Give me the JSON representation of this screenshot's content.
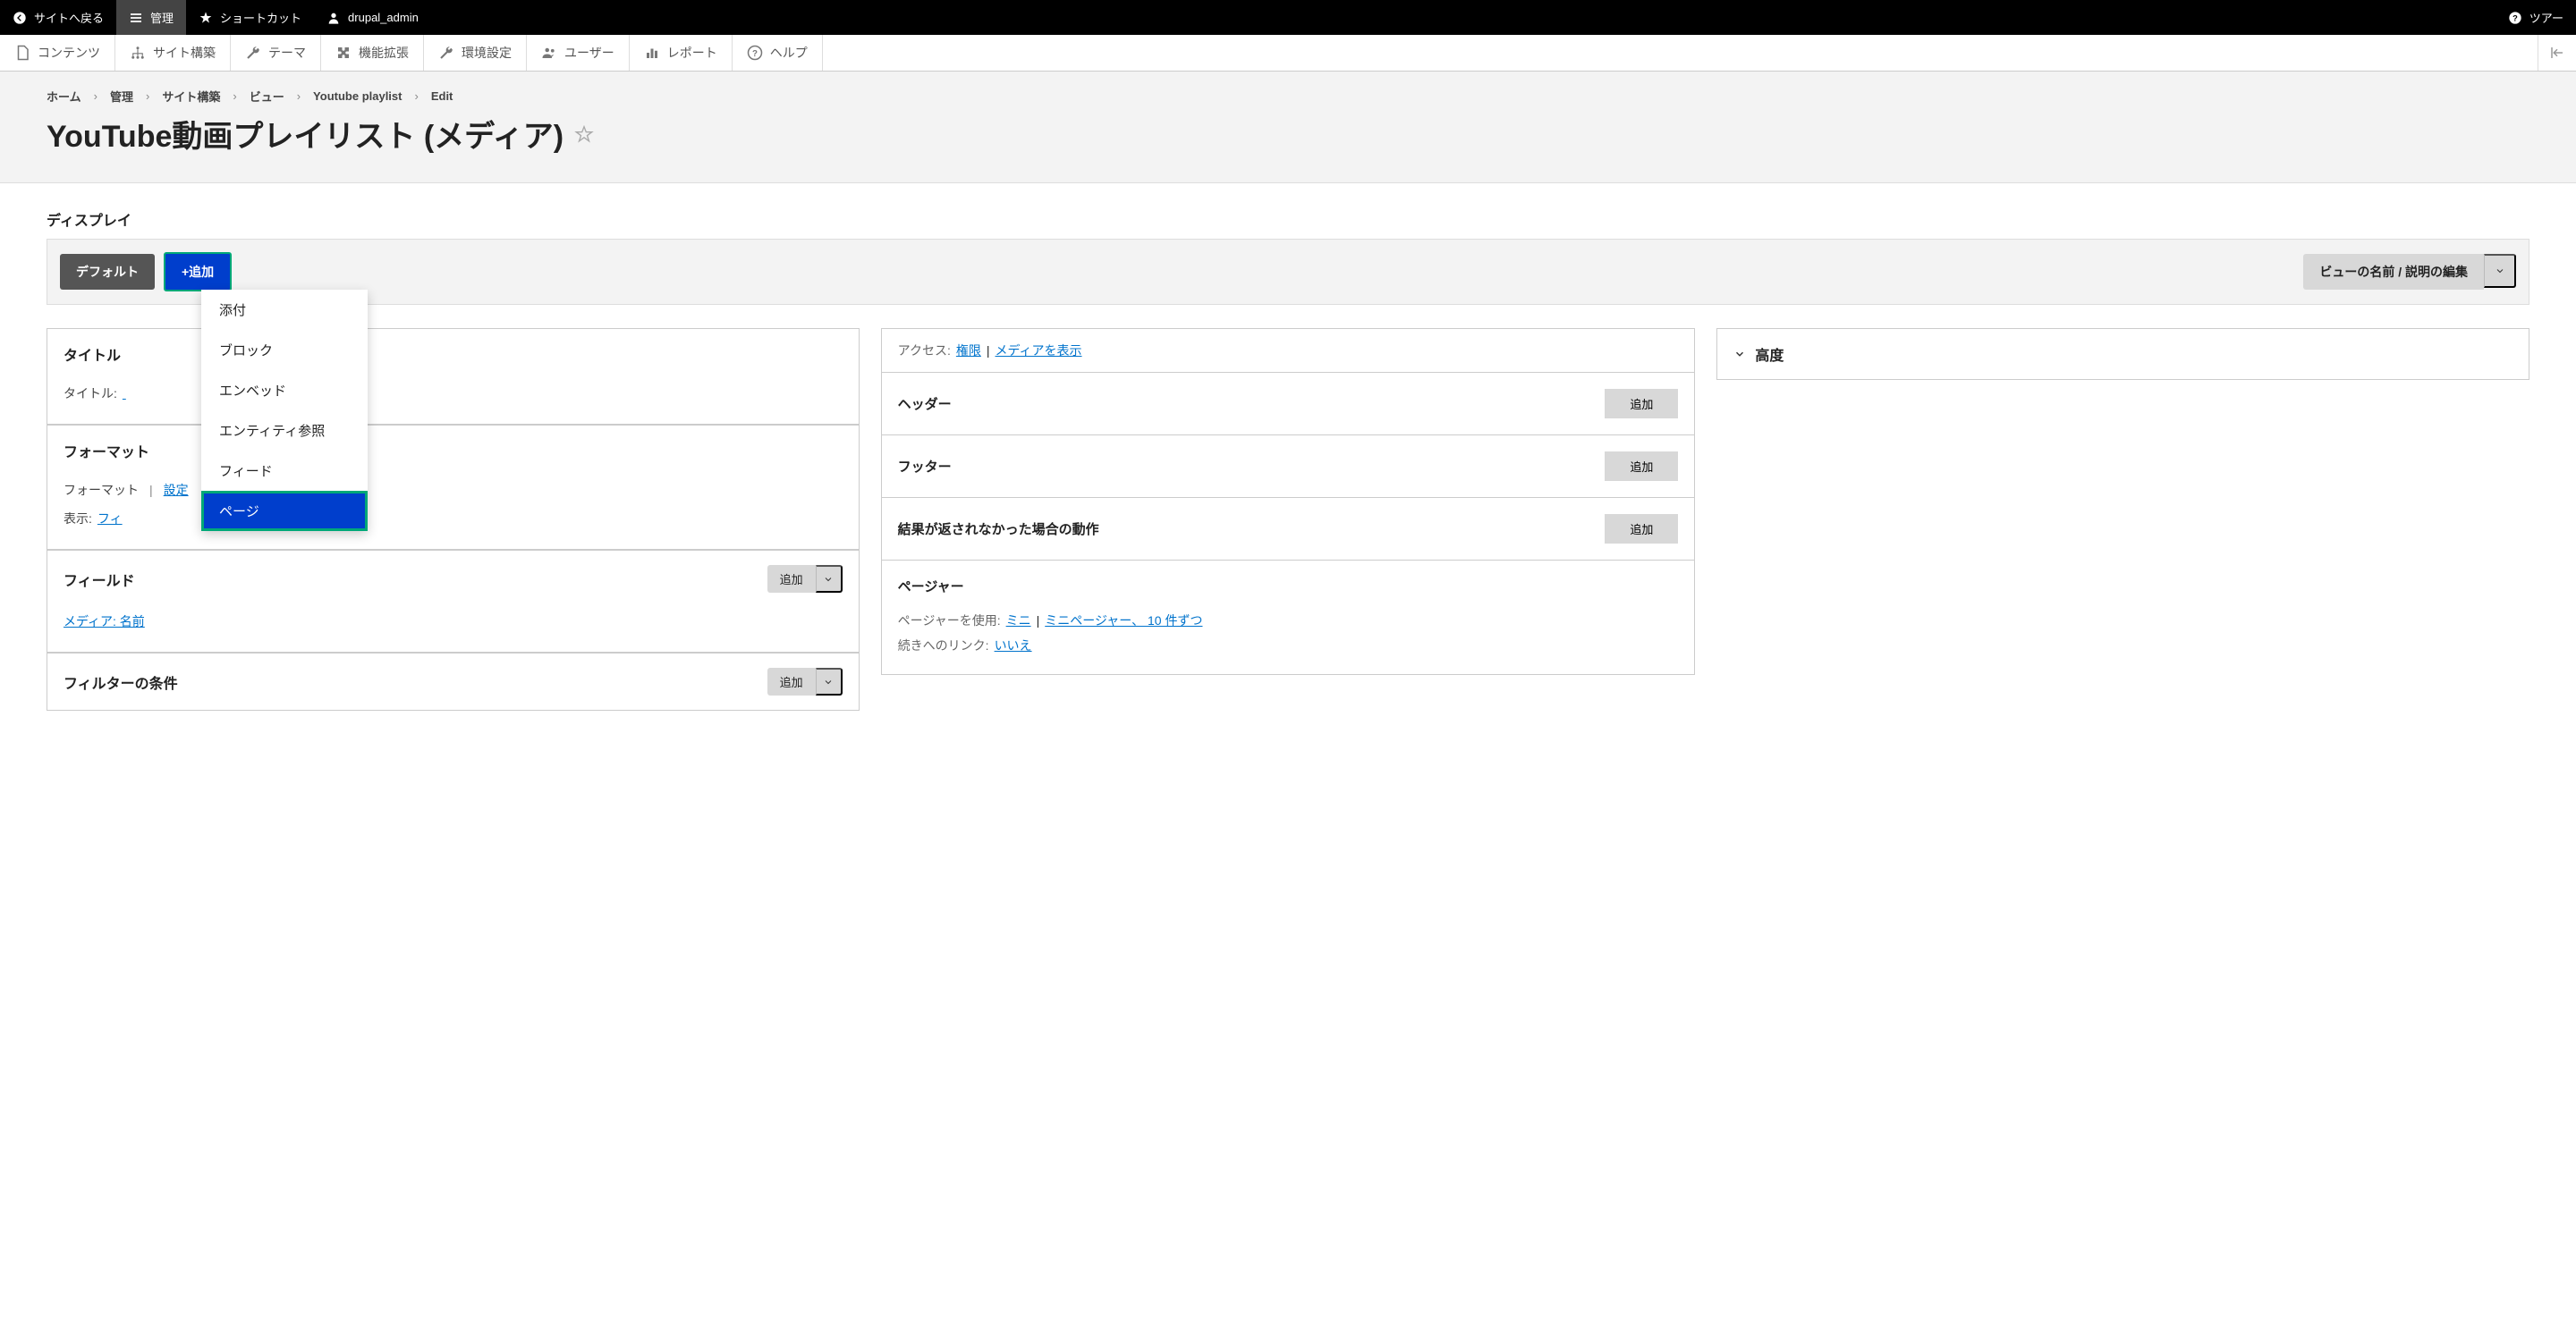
{
  "toolbar_top": {
    "back": "サイトへ戻る",
    "manage": "管理",
    "shortcuts": "ショートカット",
    "user": "drupal_admin",
    "tour": "ツアー"
  },
  "toolbar_admin": {
    "content": "コンテンツ",
    "structure": "サイト構築",
    "appearance": "テーマ",
    "extend": "機能拡張",
    "config": "環境設定",
    "people": "ユーザー",
    "reports": "レポート",
    "help": "ヘルプ"
  },
  "breadcrumb": {
    "home": "ホーム",
    "manage": "管理",
    "structure": "サイト構築",
    "views": "ビュー",
    "view_name": "Youtube playlist",
    "edit": "Edit"
  },
  "page_title": "YouTube動画プレイリスト (メディア)",
  "section_displays": "ディスプレイ",
  "displays": {
    "default": "デフォルト",
    "add": "+追加",
    "edit_name": "ビューの名前 / 説明の編集"
  },
  "dropdown": {
    "attachment": "添付",
    "block": "ブロック",
    "embed": "エンベッド",
    "entity_ref": "エンティティ参照",
    "feed": "フィード",
    "page": "ページ"
  },
  "col1": {
    "title_section": "タイトル",
    "title_label": "タイトル:",
    "format_section": "フォーマット",
    "format_label": "フォーマット",
    "format_settings": "設定",
    "show_label": "表示:",
    "show_value": "フィ",
    "fields_section": "フィールド",
    "fields_add": "追加",
    "field_media_name": "メディア: 名前",
    "filter_section": "フィルターの条件",
    "filter_add": "追加"
  },
  "col2": {
    "access_label": "アクセス:",
    "access_perm": "権限",
    "access_media": "メディアを表示",
    "header": "ヘッダー",
    "footer": "フッター",
    "no_results": "結果が返されなかった場合の動作",
    "pager": "ページャー",
    "pager_use_label": "ページャーを使用:",
    "pager_mini": "ミニ",
    "pager_settings": "ミニページャー、 10 件ずつ",
    "more_label": "続きへのリンク:",
    "more_value": "いいえ",
    "add": "追加"
  },
  "col3": {
    "advanced": "高度"
  }
}
